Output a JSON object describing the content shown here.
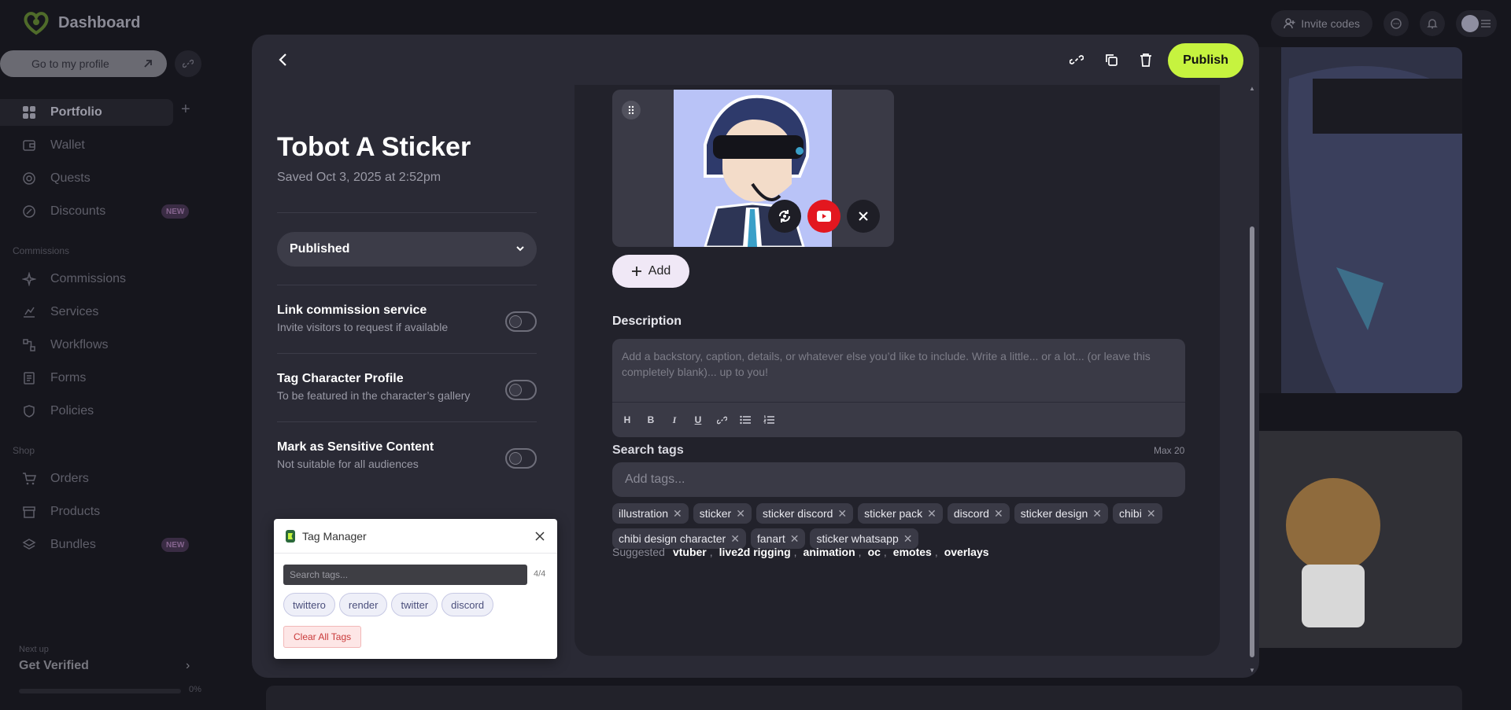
{
  "topbar": {
    "brand": "Dashboard",
    "invite_codes": "Invite codes"
  },
  "sidebar": {
    "go_to_profile": "Go to my profile",
    "items": [
      {
        "label": "Portfolio",
        "active": true
      },
      {
        "label": "Wallet"
      },
      {
        "label": "Quests"
      },
      {
        "label": "Discounts",
        "badge": "NEW"
      },
      {
        "label": "Commissions"
      },
      {
        "label": "Services"
      },
      {
        "label": "Workflows"
      },
      {
        "label": "Forms"
      },
      {
        "label": "Policies"
      },
      {
        "label": "Orders"
      },
      {
        "label": "Products"
      },
      {
        "label": "Bundles",
        "badge": "NEW"
      }
    ],
    "sections": {
      "commissions": "Commissions",
      "shop": "Shop"
    },
    "next_up": "Next up",
    "get_verified": "Get Verified",
    "progress_percent": "0%",
    "progress_value": 0
  },
  "modal": {
    "publish_label": "Publish",
    "title": "Tobot A Sticker",
    "saved": "Saved Oct 3, 2025 at 2:52pm",
    "status": "Published",
    "toggles": [
      {
        "title": "Link commission service",
        "subtitle": "Invite visitors to request if available",
        "on": false
      },
      {
        "title": "Tag Character Profile",
        "subtitle": "To be featured in the character’s gallery",
        "on": false
      },
      {
        "title": "Mark as Sensitive Content",
        "subtitle": "Not suitable for all audiences",
        "on": false
      }
    ],
    "add_label": "Add",
    "description_label": "Description",
    "description_placeholder": "Add a backstory, caption, details, or whatever else you’d like to include. Write a little... or a lot... (or leave this completely blank)... up to you!",
    "toolbar": [
      "H",
      "B",
      "I",
      "U"
    ],
    "search_tags_label": "Search tags",
    "max_tags": "Max 20",
    "tags_placeholder": "Add tags...",
    "tags": [
      "illustration",
      "sticker",
      "sticker discord",
      "sticker pack",
      "discord",
      "sticker design",
      "chibi",
      "chibi design character",
      "fanart",
      "sticker whatsapp"
    ],
    "suggested_label": "Suggested",
    "suggested": [
      "vtuber",
      "live2d rigging",
      "animation",
      "oc",
      "emotes",
      "overlays"
    ]
  },
  "tag_manager": {
    "title": "Tag Manager",
    "search_placeholder": "Search tags...",
    "count": "4/4",
    "tags": [
      "twittero",
      "render",
      "twitter",
      "discord"
    ],
    "clear_label": "Clear All Tags"
  },
  "colors": {
    "accent": "#c6f33f",
    "youtube": "#e3171f",
    "modal_bg": "#2a2a35"
  }
}
